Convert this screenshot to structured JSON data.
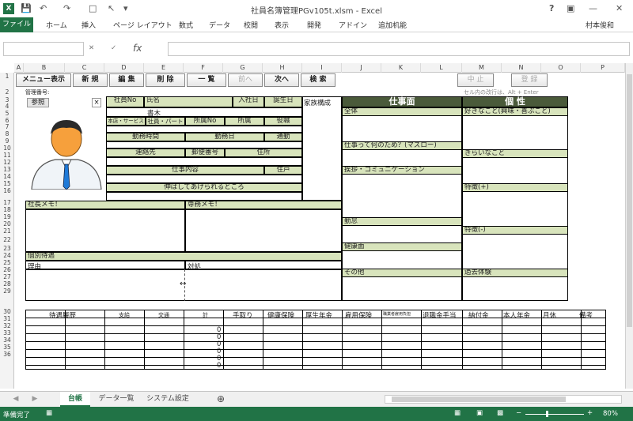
{
  "window": {
    "title": "社員名簿管理PGv105t.xlsm - Excel",
    "app_icon": "excel-icon",
    "help": "?",
    "minimize": "—",
    "close": "✕"
  },
  "ribbon": {
    "file": "ファイル",
    "tabs": [
      "ホーム",
      "挿入",
      "ページ レイアウト",
      "数式",
      "データ",
      "校閲",
      "表示",
      "開発",
      "アドイン",
      "追加机能"
    ],
    "user": "村本俊和"
  },
  "formula": {
    "name_box": "",
    "fx": "fx",
    "value": ""
  },
  "columns": [
    "A",
    "B",
    "C",
    "D",
    "E",
    "F",
    "G",
    "H",
    "I",
    "J",
    "K",
    "L",
    "M",
    "N",
    "O",
    "P"
  ],
  "rows": [
    "1",
    "2",
    "3",
    "4",
    "5",
    "6",
    "7",
    "8",
    "9",
    "10",
    "11",
    "12",
    "13",
    "14",
    "15",
    "16",
    "17",
    "18",
    "19",
    "20",
    "21",
    "22",
    "23",
    "24",
    "25",
    "26",
    "27",
    "28",
    "29",
    "30",
    "31",
    "32",
    "33",
    "34",
    "35",
    "36"
  ],
  "toolbar": {
    "menu": "メニュー表示",
    "new": "新 規",
    "edit": "編 集",
    "delete": "削 除",
    "list": "一 覧",
    "prev": "前へ",
    "next": "次へ",
    "search": "検 索",
    "stop": "中 止",
    "register": "登 録"
  },
  "row2": {
    "mgmt": "管理番号:",
    "hint": "セル内の改行は、Alt + Enter"
  },
  "card": {
    "photo": "参照",
    "close": "×",
    "emp_no": "社員No",
    "name": "氏名",
    "kana": "書木",
    "join": "入社日",
    "birth": "誕生日",
    "family": "家族構成",
    "dept_main": "本店・サービス",
    "emp_type": "社員・パート",
    "dept_no": "所属No",
    "dept": "所属",
    "position": "役職",
    "work_hours": "勤務時間",
    "work_days": "勤務日",
    "commute": "通勤",
    "contact": "連絡先",
    "postal": "郵便番号",
    "address": "住所",
    "job": "仕事内容",
    "residence": "住戸",
    "strengths": "伸ばしてあげられるところ",
    "boss_memo": "社長メモ！",
    "exec_memo": "専務メモ！",
    "individual": "個別待遇",
    "reason": "理由",
    "action": "対処"
  },
  "work": {
    "header": "仕事面",
    "all": "全体",
    "purpose": "仕事って何のため？(マズロー)",
    "greet": "挨拶・コミュニケーション",
    "attendance": "勤怠",
    "health": "健康面",
    "other": "その他"
  },
  "personality": {
    "header": "個 性",
    "likes": "好きなこと(興味・喜ぶこと)",
    "dislikes": "きらいなこと",
    "plus": "特徴(+)",
    "minus": "特徴(-)",
    "past": "過去体験"
  },
  "pay": {
    "history": "待遇履歴",
    "base": "支給",
    "transport": "交通",
    "total": "計",
    "net": "手取り",
    "health_ins": "健康保険",
    "pension": "厚生年金",
    "emp_ins": "雇用保険",
    "nursing": "職業者雇用負担",
    "retire": "退職金手当",
    "paid": "納付金",
    "personal_pension": "本人年金",
    "monthly": "月休",
    "note": "備考",
    "zeros": [
      "0",
      "0",
      "0",
      "0",
      "0",
      "0",
      "0"
    ]
  },
  "sheets": [
    "台帳",
    "データ一覧",
    "システム設定"
  ],
  "status": {
    "ready": "準備完了",
    "zoom": "80%",
    "minus": "−",
    "plus": "+"
  }
}
